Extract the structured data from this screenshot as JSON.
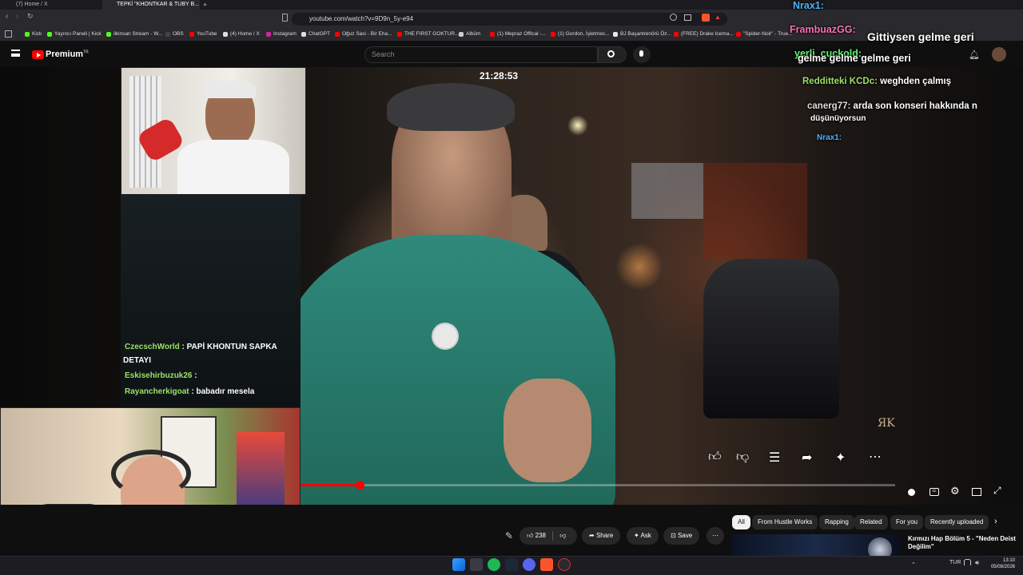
{
  "browser": {
    "tabs": [
      {
        "label": "(7) Home / X"
      },
      {
        "label": "TEPKİ \"KHONTKAR & TUBY B..."
      }
    ],
    "url": "youtube.com/watch?v=9D9n_5y-e94",
    "bookmarks": [
      {
        "label": "Kick",
        "color": "#53fc18"
      },
      {
        "label": "Yayıncı Paneli | Kick",
        "color": "#53fc18"
      },
      {
        "label": "ilkinsan Stream - W...",
        "color": "#53fc18"
      },
      {
        "label": "OBS",
        "color": "#444444"
      },
      {
        "label": "YouTube",
        "color": "#ff0000"
      },
      {
        "label": "(4) Home / X",
        "color": "#dddddd"
      },
      {
        "label": "Instagram",
        "color": "#d6249f"
      },
      {
        "label": "ChatGPT",
        "color": "#dddddd"
      },
      {
        "label": "Oğuz Sasi - Bir Eha...",
        "color": "#ff0000"
      },
      {
        "label": "THE FIRST GOKTUR...",
        "color": "#ff0000"
      },
      {
        "label": "Albüm",
        "color": "#cccccc"
      },
      {
        "label": "(1) Mepraz Offical -...",
        "color": "#ff0000"
      },
      {
        "label": "(1) Gordon, İşletmec...",
        "color": "#ff0000"
      },
      {
        "label": "BJ Başantrenörü Öz...",
        "color": "#e8e8e8"
      },
      {
        "label": "(FREE) Drake Icema...",
        "color": "#ff0000"
      },
      {
        "label": "\"Spider-Noir\" - True...",
        "color": "#ff0000"
      }
    ]
  },
  "youtube": {
    "logo_text": "Premium",
    "logo_sup": "TR",
    "search_placeholder": "Search"
  },
  "overlay": {
    "clock": "21:28:53",
    "watermark": "ЯK",
    "left_chat": [
      {
        "user": "CzecschWorld",
        "text": ": PAPİ KHONTUN SAPKA"
      },
      {
        "user": "",
        "text": "DETAYI"
      },
      {
        "user": "Eskisehirbuzuk26",
        "text": ":"
      },
      {
        "user": "Rayancherkigoat",
        "text": ": babadır mesela"
      }
    ],
    "right_chat": [
      {
        "user": "Nrax1:",
        "text": "",
        "color": "#4fb3ff"
      },
      {
        "user": "FrambuazGG:",
        "text": "",
        "color": "#ff6fb5"
      },
      {
        "user": "",
        "text": "Gittiysen  gelme geri",
        "color": "#ffffff"
      },
      {
        "user": "yerli_cuckold:",
        "text": "",
        "color": "#5cff6b"
      },
      {
        "user": "",
        "text": "gelme  gelme  gelme  geri",
        "color": "#ffffff"
      },
      {
        "user": "Redditteki KCDc:",
        "text": "weghden çalmış",
        "color": "#9be26a"
      },
      {
        "user": "canerg77:",
        "text": "arda son konseri hakkında n",
        "color": "#ffffff"
      },
      {
        "user": "",
        "text": "düşünüyorsun",
        "color": "#ffffff"
      },
      {
        "user": "Nrax1:",
        "text": "",
        "color": "#4fb3ff"
      }
    ]
  },
  "actions": {
    "like_count": "238",
    "share_label": "Share",
    "ask_label": "Ask",
    "save_label": "Save"
  },
  "chips": [
    {
      "label": "All",
      "selected": true
    },
    {
      "label": "From Hustle Works",
      "selected": false
    },
    {
      "label": "Rapping",
      "selected": false
    },
    {
      "label": "Related",
      "selected": false
    },
    {
      "label": "For you",
      "selected": false
    },
    {
      "label": "Recently uploaded",
      "selected": false
    }
  ],
  "related": {
    "title_line1": "Kırmızı Hap Bölüm 5 - \"Neden Deist",
    "title_line2": "Değilim\""
  },
  "player": {
    "progress_fraction": 0.1
  },
  "taskbar": {
    "lang": "TUR",
    "time": "13:10",
    "date": "05/08/2026"
  },
  "colors": {
    "accent": "#ff0000",
    "chat_user": "#9be26a"
  }
}
